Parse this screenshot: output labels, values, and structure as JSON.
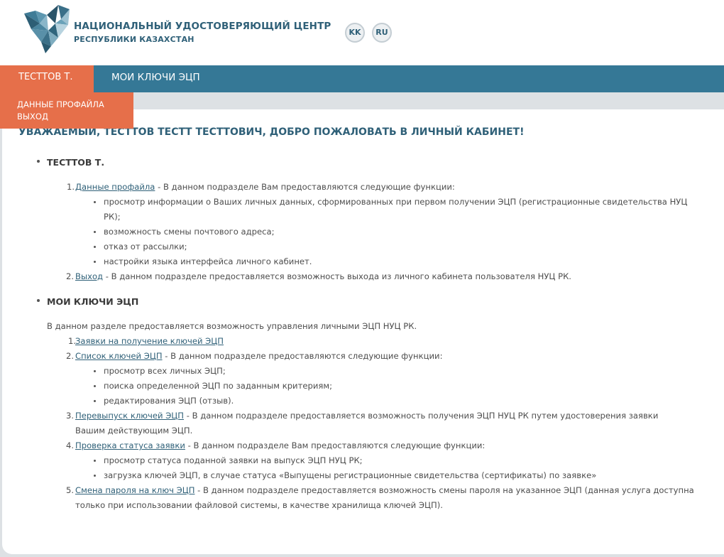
{
  "header": {
    "title": "НАЦИОНАЛЬНЫЙ УДОСТОВЕРЯЮЩИЙ ЦЕНТР",
    "subtitle": "РЕСПУБЛИКИ КАЗАХСТАН",
    "lang_kk": "KK",
    "lang_ru": "RU"
  },
  "nav": {
    "user": "ТЕСТТОВ Т.",
    "keys": "МОИ КЛЮЧИ ЭЦП",
    "dropdown": [
      "ДАННЫЕ ПРОФАЙЛА",
      "ВЫХОД"
    ]
  },
  "main": {
    "welcome": "УВАЖАЕМЫЙ, ТЕСТТОВ ТЕСТТ ТЕСТТОВИЧ, ДОБРО ПОЖАЛОВАТЬ В ЛИЧНЫЙ КАБИНЕТ!",
    "section1": {
      "title": "ТЕСТТОВ Т.",
      "items": [
        {
          "num": "1.",
          "link": "Данные профайла",
          "text": " - В данном подразделе Вам предоставляются следующие функции:",
          "subs": [
            "просмотр информации о Ваших личных данных, сформированных при первом получении ЭЦП (регистрационные свидетельства НУЦ",
            "РК);",
            "возможность смены почтового адреса;",
            "отказ от рассылки;",
            "настройки языка интерфейса личного кабинет."
          ]
        },
        {
          "num": "2.",
          "link": "Выход",
          "text": " - В данном подразделе предоставляется возможность выхода из личного кабинета пользователя НУЦ РК."
        }
      ]
    },
    "section2": {
      "title": "МОИ КЛЮЧИ ЭЦП",
      "intro": "В данном разделе предоставляется возможность управления личными ЭЦП НУЦ РК.",
      "items": [
        {
          "num": "1.",
          "link": "Заявки на получение ключей ЭЦП",
          "text": ""
        },
        {
          "num": "2.",
          "link": "Список ключей ЭЦП",
          "text": " - В данном подразделе предоставляются следующие функции:",
          "subs": [
            "просмотр всех личных ЭЦП;",
            "поиска определенной ЭЦП по заданным критериям;",
            "редактирования ЭЦП (отзыв)."
          ]
        },
        {
          "num": "3.",
          "link": "Перевыпуск ключей ЭЦП",
          "text": " - В данном подразделе предоставляется возможность получения ЭЦП НУЦ РК путем удостоверения заявки",
          "cont": "Вашим действующим ЭЦП."
        },
        {
          "num": "4.",
          "link": "Проверка статуса заявки",
          "text": " - В данном подразделе Вам предоставляются следующие функции:",
          "subs": [
            "просмотр статуса поданной заявки на выпуск ЭЦП НУЦ РК;",
            "загрузка ключей ЭЦП, в случае статуса «Выпущены регистрационные свидетельства (сертификаты) по заявке»"
          ]
        },
        {
          "num": "5.",
          "link": "Смена пароля на ключ ЭЦП",
          "text": " - В данном подразделе предоставляется возможность смены пароля на указанное ЭЦП (данная услуга доступна",
          "cont": "только при использовании файловой системы, в качестве хранилища ключей ЭЦП)."
        }
      ]
    }
  }
}
